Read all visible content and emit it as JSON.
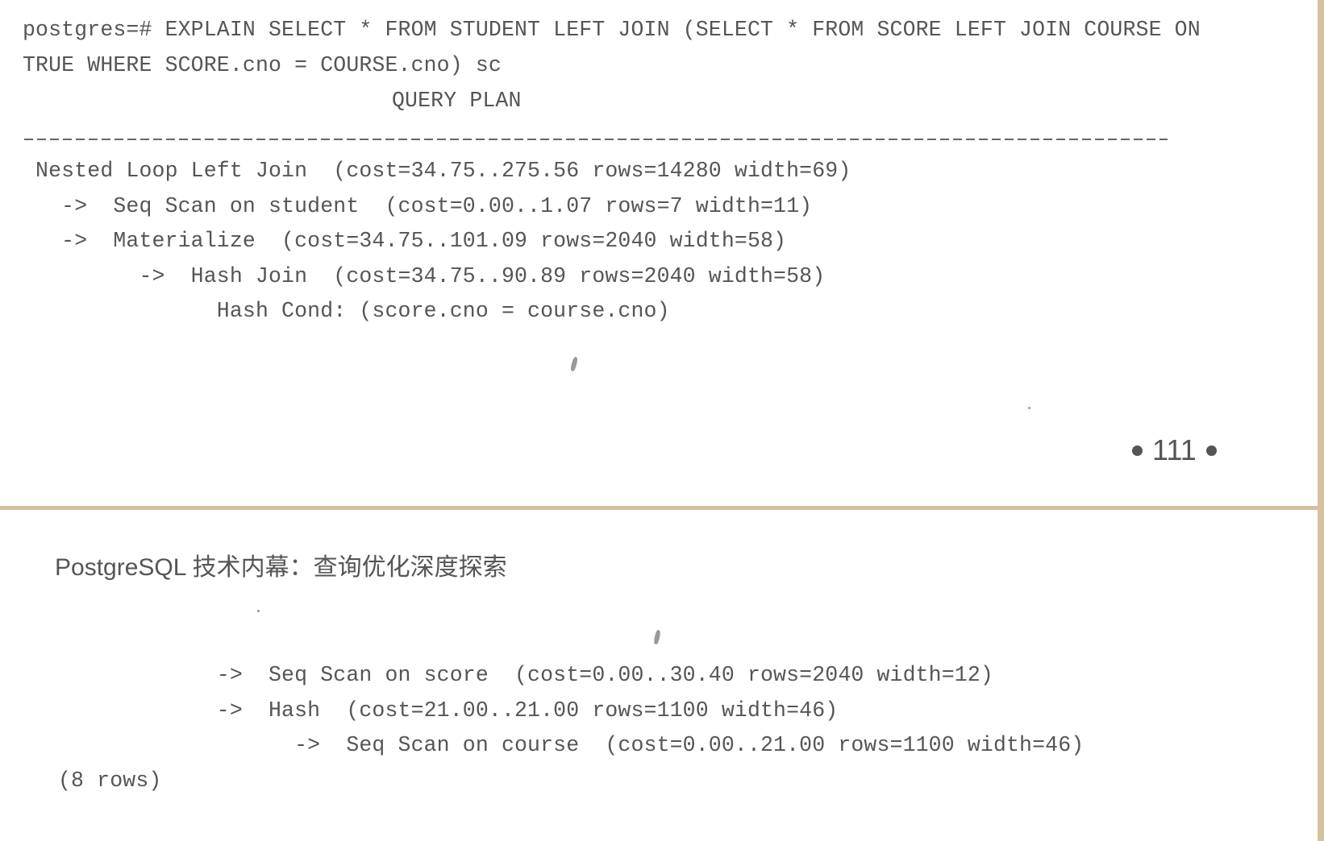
{
  "top_page": {
    "command_lines": [
      "postgres=# EXPLAIN SELECT * FROM STUDENT LEFT JOIN (SELECT * FROM SCORE LEFT JOIN COURSE ON",
      "TRUE WHERE SCORE.cno = COURSE.cno) sc"
    ],
    "result_header": "QUERY PLAN",
    "plan_lines": [
      " Nested Loop Left Join  (cost=34.75..275.56 rows=14280 width=69)",
      "   ->  Seq Scan on student  (cost=0.00..1.07 rows=7 width=11)",
      "   ->  Materialize  (cost=34.75..101.09 rows=2040 width=58)",
      "         ->  Hash Join  (cost=34.75..90.89 rows=2040 width=58)",
      "               Hash Cond: (score.cno = course.cno)"
    ],
    "page_number": "111"
  },
  "bottom_page": {
    "running_header": "PostgreSQL 技术内幕：查询优化深度探索",
    "plan_lines": [
      "               ->  Seq Scan on score  (cost=0.00..30.40 rows=2040 width=12)",
      "               ->  Hash  (cost=21.00..21.00 rows=1100 width=46)",
      "                     ->  Seq Scan on course  (cost=0.00..21.00 rows=1100 width=46)"
    ],
    "row_count": "(8 rows)"
  },
  "colors": {
    "text": "#555555",
    "page": "#ffffff",
    "binding_edge": "#d9c5a3"
  }
}
